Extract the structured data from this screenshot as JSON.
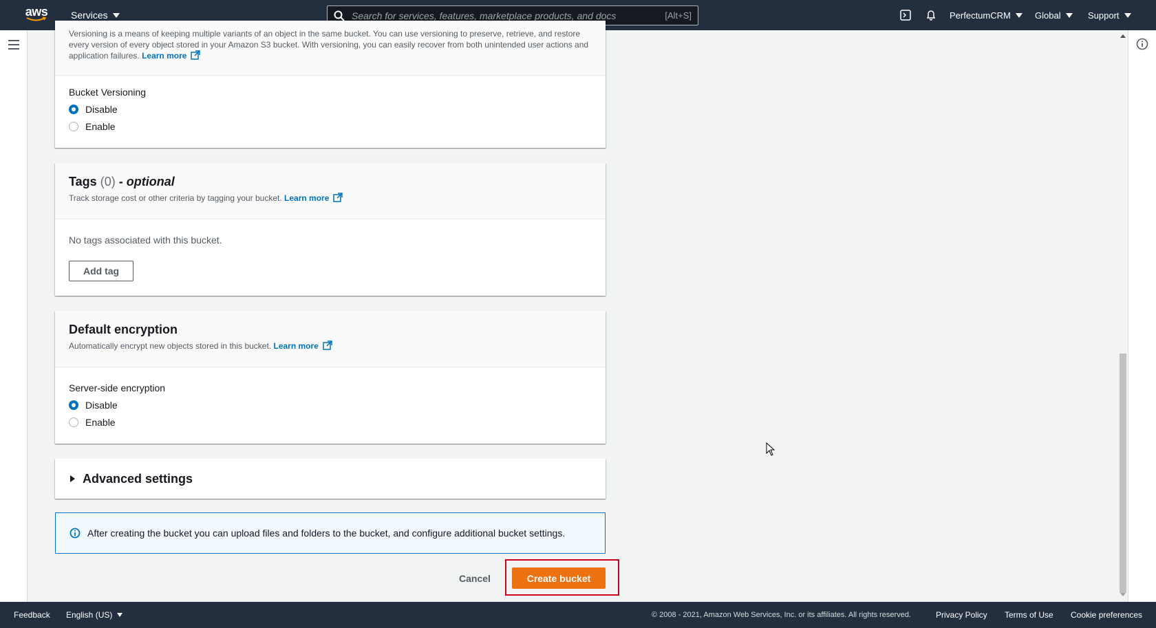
{
  "topnav": {
    "logo_text": "aws",
    "services_label": "Services",
    "search_placeholder": "Search for services, features, marketplace products, and docs",
    "search_shortcut": "[Alt+S]",
    "account_label": "PerfectumCRM",
    "region_label": "Global",
    "support_label": "Support"
  },
  "versioning": {
    "description": "Versioning is a means of keeping multiple variants of an object in the same bucket. You can use versioning to preserve, retrieve, and restore every version of every object stored in your Amazon S3 bucket. With versioning, you can easily recover from both unintended user actions and application failures.",
    "learn_more": "Learn more",
    "field_label": "Bucket Versioning",
    "options": [
      "Disable",
      "Enable"
    ],
    "selected": "Disable"
  },
  "tags": {
    "title": "Tags",
    "count": "(0)",
    "optional": "- optional",
    "description": "Track storage cost or other criteria by tagging your bucket.",
    "learn_more": "Learn more",
    "empty_text": "No tags associated with this bucket.",
    "add_button": "Add tag"
  },
  "encryption": {
    "title": "Default encryption",
    "description": "Automatically encrypt new objects stored in this bucket.",
    "learn_more": "Learn more",
    "field_label": "Server-side encryption",
    "options": [
      "Disable",
      "Enable"
    ],
    "selected": "Disable"
  },
  "advanced": {
    "title": "Advanced settings"
  },
  "info_alert": {
    "text": "After creating the bucket you can upload files and folders to the bucket, and configure additional bucket settings."
  },
  "actions": {
    "cancel": "Cancel",
    "create": "Create bucket"
  },
  "footer": {
    "feedback": "Feedback",
    "language": "English (US)",
    "copyright": "© 2008 - 2021, Amazon Web Services, Inc. or its affiliates. All rights reserved.",
    "privacy": "Privacy Policy",
    "terms": "Terms of Use",
    "cookies": "Cookie preferences"
  },
  "colors": {
    "nav_bg": "#232f3e",
    "primary_orange": "#ec7211",
    "link_blue": "#0073bb",
    "highlight_red": "#d0021b"
  }
}
